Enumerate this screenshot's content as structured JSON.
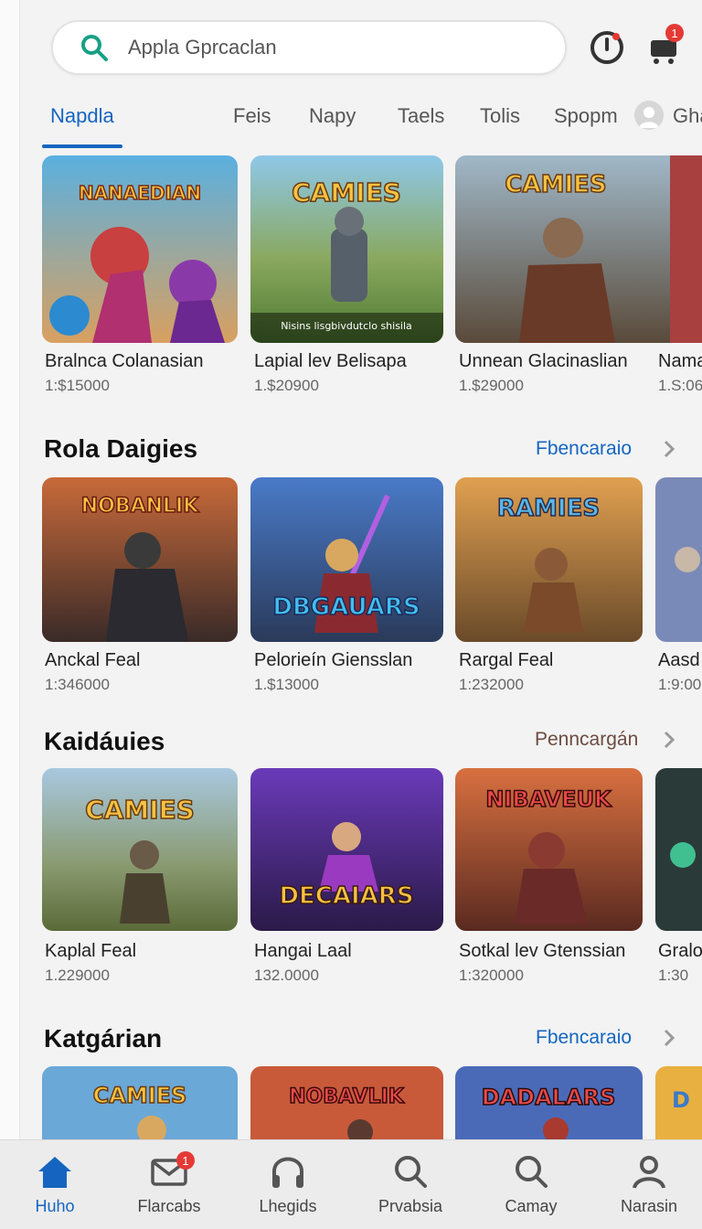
{
  "colors": {
    "accent": "#1565c0",
    "badge": "#e53935",
    "link_secondary": "#6d4c41"
  },
  "header": {
    "search_text": "Appla Gprcaclan",
    "notifications_badge": "1",
    "alert_icon": "clock-alert-icon",
    "cart_icon": "cart-icon"
  },
  "tabs": [
    {
      "label": "Napdla",
      "active": true
    },
    {
      "label": "Feis"
    },
    {
      "label": "Napy"
    },
    {
      "label": "Taels"
    },
    {
      "label": "Tolis"
    },
    {
      "label": "Spopm"
    },
    {
      "label": "Gha"
    }
  ],
  "featured": [
    {
      "title": "Bralnca Colanasian",
      "price": "1:$15000",
      "art_text": "NANAEDIAN"
    },
    {
      "title": "Lapial lev Belisapa",
      "price": "1.$20900",
      "art_text": "CAMIES",
      "caption": "Nisins lisgbivdutclo shisila"
    },
    {
      "title": "Unnean Glacinaslian",
      "price": "1.$29000",
      "art_text": "CAMIES"
    },
    {
      "title": "Nama",
      "price": "1.S:06"
    }
  ],
  "sections": [
    {
      "title": "Rola Daigies",
      "link": "Fbencaraio",
      "items": [
        {
          "title": "Anckal Feal",
          "price": "1:346000",
          "art_text": "NOBANLIK"
        },
        {
          "title": "Pelorieín Giensslan",
          "price": "1.$13000",
          "art_text": "DBGAUARS"
        },
        {
          "title": "Rargal Feal",
          "price": "1:232000",
          "art_text": "RAMIES"
        },
        {
          "title": "Aasd",
          "price": "1:9:00"
        }
      ]
    },
    {
      "title": "Kaidáuies",
      "link": "Penncargán",
      "items": [
        {
          "title": "Kaplal Feal",
          "price": "1.229000",
          "art_text": "CAMIES"
        },
        {
          "title": "Hangai Laal",
          "price": "132.0000",
          "art_text": "DECAIARS"
        },
        {
          "title": "Sotkal lev Gtenssian",
          "price": "1:320000",
          "art_text": "NIBAVEUK"
        },
        {
          "title": "Gralo",
          "price": "1:30"
        }
      ]
    },
    {
      "title": "Katgárian",
      "link": "Fbencaraio",
      "items": [
        {
          "art_text": "CAMIES"
        },
        {
          "art_text": "NOBAVLIK"
        },
        {
          "art_text": "DADALARS"
        },
        {
          "art_text": "D"
        }
      ]
    }
  ],
  "bottom_nav": [
    {
      "label": "Huho",
      "icon": "home-icon",
      "active": true
    },
    {
      "label": "Flarcabs",
      "icon": "mail-icon",
      "badge": "1"
    },
    {
      "label": "Lhegids",
      "icon": "headphones-icon"
    },
    {
      "label": "Prvabsia",
      "icon": "search-icon"
    },
    {
      "label": "Camay",
      "icon": "search-icon"
    },
    {
      "label": "Narasin",
      "icon": "profile-icon"
    }
  ]
}
